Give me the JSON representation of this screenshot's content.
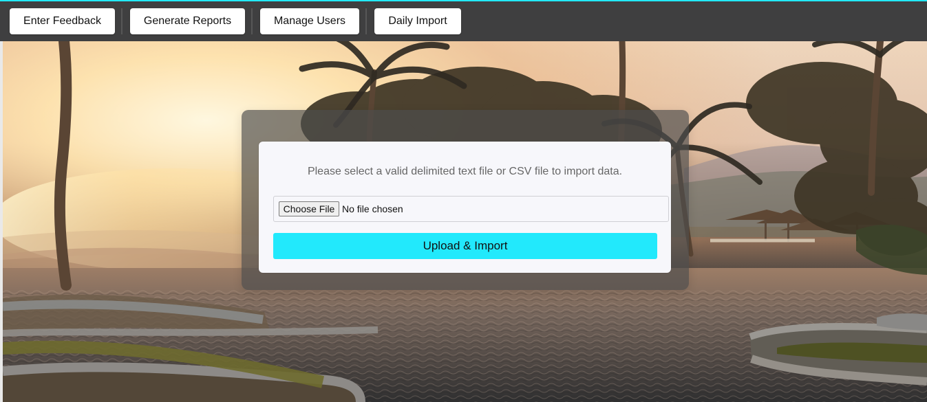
{
  "theme": {
    "accent_top_border": "#22e9fc",
    "toolbar_background": "#3f3f40",
    "button_background": "#ffffff",
    "upload_button": "#22e9fc",
    "card_background": "#f7f7fb"
  },
  "nav": {
    "items": [
      {
        "label": "Enter Feedback"
      },
      {
        "label": "Generate Reports"
      },
      {
        "label": "Manage Users"
      },
      {
        "label": "Daily Import"
      }
    ]
  },
  "import": {
    "message": "Please select a valid delimited text file or CSV file to import data.",
    "choose_file_label": "Choose File",
    "file_status": "No file chosen",
    "upload_label": "Upload & Import"
  },
  "background": {
    "image_subject": "tropical resort pool at sunset"
  }
}
